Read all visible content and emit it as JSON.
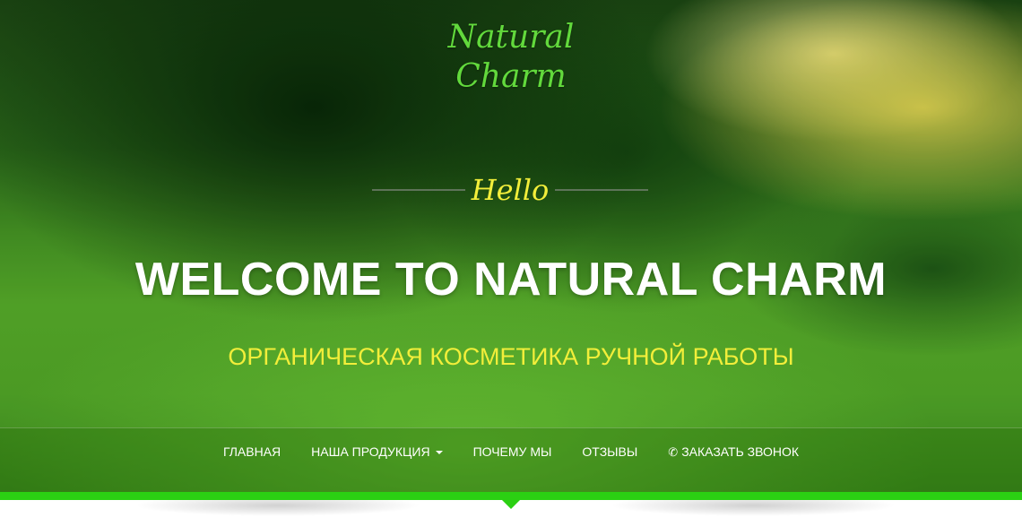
{
  "logo": {
    "line1": "Natural",
    "line2": "Charm"
  },
  "hero": {
    "hello": "Hello",
    "headline": "WELCOME TO NATURAL CHARM",
    "tagline": "ОРГАНИЧЕСКАЯ КОСМЕТИКА РУЧНОЙ РАБОТЫ"
  },
  "nav": {
    "items": [
      {
        "label": "ГЛАВНАЯ"
      },
      {
        "label": "НАША ПРОДУКЦИЯ",
        "icon": "caret-down-icon"
      },
      {
        "label": "ПОЧЕМУ МЫ"
      },
      {
        "label": "ОТЗЫВЫ"
      },
      {
        "label": "ЗАКАЗАТЬ ЗВОНОК",
        "icon": "phone-icon"
      }
    ]
  },
  "colors": {
    "logo": "#62d93c",
    "accent_yellow": "#f2ee3a",
    "accent_green": "#2bd013"
  }
}
